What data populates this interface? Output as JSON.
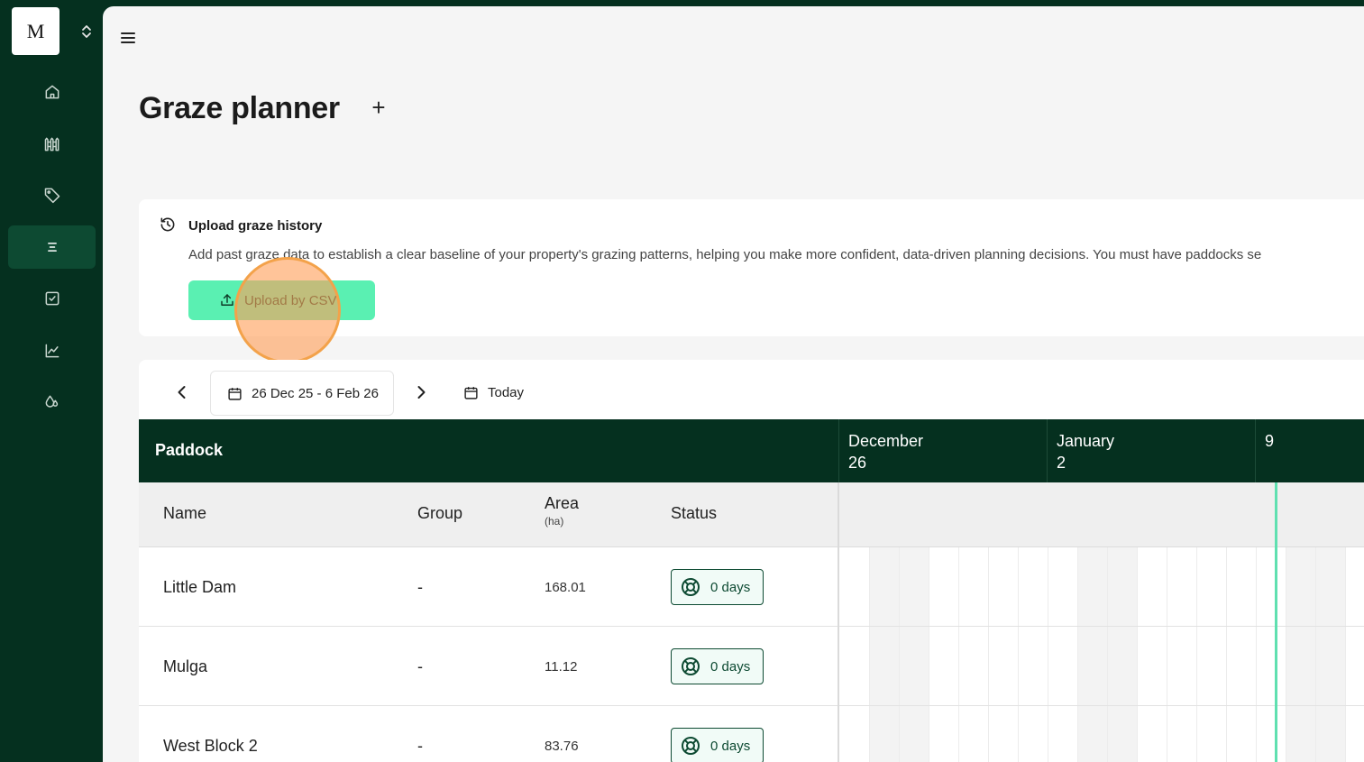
{
  "app": {
    "logo_letter": "M"
  },
  "sidebar": {
    "items": [
      {
        "icon": "home-icon"
      },
      {
        "icon": "fence-icon"
      },
      {
        "icon": "tag-icon"
      },
      {
        "icon": "planner-icon",
        "active": true
      },
      {
        "icon": "checkbox-icon"
      },
      {
        "icon": "chart-icon"
      },
      {
        "icon": "rain-icon"
      }
    ]
  },
  "header": {
    "title": "Graze planner",
    "add_label": "+"
  },
  "upload": {
    "title": "Upload graze history",
    "description": "Add past graze data to establish a clear baseline of your property's grazing patterns, helping you make more confident, data-driven planning decisions. You must have paddocks se",
    "button_label": "Upload by CSV"
  },
  "toolbar": {
    "date_range": "26 Dec 25 - 6 Feb 26",
    "today_label": "Today"
  },
  "grid": {
    "paddock_header": "Paddock",
    "months": [
      {
        "month": "December",
        "day": "26"
      },
      {
        "month": "January",
        "day": "2"
      },
      {
        "month": "",
        "day": "9"
      }
    ],
    "columns": {
      "name": "Name",
      "group": "Group",
      "area": "Area",
      "area_unit": "(ha)",
      "status": "Status"
    },
    "rows": [
      {
        "name": "Little Dam",
        "group": "-",
        "area": "168.01",
        "status": "0 days"
      },
      {
        "name": "Mulga",
        "group": "-",
        "area": "11.12",
        "status": "0 days"
      },
      {
        "name": "West Block 2",
        "group": "-",
        "area": "83.76",
        "status": "0 days"
      }
    ]
  },
  "colors": {
    "sidebar_bg": "#05301f",
    "accent": "#5af0b2",
    "today_line": "#5fe0b0"
  }
}
